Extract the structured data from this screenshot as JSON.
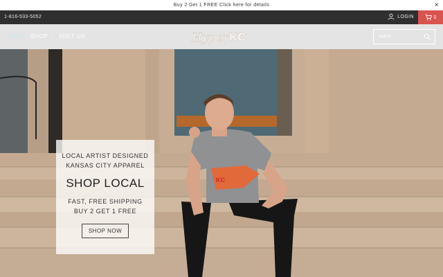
{
  "announcement": {
    "text": "Buy 2 Get 1 FREE  Click here for details",
    "close_label": "×"
  },
  "utility": {
    "phone": "1-816-533-5052",
    "login_label": "LOGIN",
    "cart_count": "0",
    "cart_color": "#d9534f"
  },
  "nav": {
    "items": [
      {
        "label": "HOME"
      },
      {
        "label": "SHOP"
      },
      {
        "label": "VISIT US"
      }
    ]
  },
  "logo": {
    "text_left": "Hyper",
    "text_right": "KC"
  },
  "search": {
    "placeholder": "Search"
  },
  "hero": {
    "promo": {
      "line1": "LOCAL ARTIST DESIGNED",
      "line2": "KANSAS CITY APPAREL",
      "title": "SHOP LOCAL",
      "ship1": "FAST, FREE SHIPPING",
      "ship2": "BUY 2 GET 1 FREE",
      "button": "SHOP NOW"
    }
  },
  "icons": [
    "close-icon",
    "user-icon",
    "cart-icon",
    "chevron-down-icon",
    "search-icon"
  ]
}
